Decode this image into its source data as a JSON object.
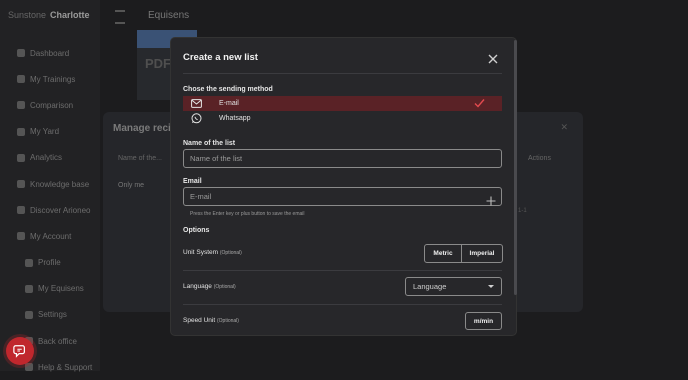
{
  "app": {
    "brand_prefix": "Sunstone",
    "brand_name": "Charlotte",
    "page_title": "Equisens",
    "card_title": "PDF"
  },
  "sidebar": {
    "items": [
      {
        "label": "Dashboard",
        "icon": "dashboard-icon"
      },
      {
        "label": "My Trainings",
        "icon": "horse-icon"
      },
      {
        "label": "Comparison",
        "icon": "compare-icon"
      },
      {
        "label": "My Yard",
        "icon": "yard-icon"
      },
      {
        "label": "Analytics",
        "icon": "analytics-icon"
      },
      {
        "label": "Knowledge base",
        "icon": "bulb-icon"
      },
      {
        "label": "Discover Arioneo",
        "icon": "globe-icon"
      },
      {
        "label": "My Account",
        "icon": "account-icon"
      },
      {
        "label": "Profile",
        "icon": "user-icon"
      },
      {
        "label": "My Equisens",
        "icon": "device-icon"
      },
      {
        "label": "Settings",
        "icon": "gear-icon"
      },
      {
        "label": "Back office",
        "icon": "shield-icon"
      },
      {
        "label": "Help & Support",
        "icon": "help-icon"
      }
    ]
  },
  "background_panel": {
    "title": "Manage recip",
    "col_name": "Name of the...",
    "col_actions": "Actions",
    "row_1": "Only me",
    "pagination": "1-1"
  },
  "modal": {
    "title": "Create a new list",
    "method_label": "Chose the sending method",
    "methods": [
      {
        "label": "E-mail",
        "icon": "mail-icon",
        "selected": true
      },
      {
        "label": "Whatsapp",
        "icon": "whatsapp-icon",
        "selected": false
      }
    ],
    "name_label": "Name of the list",
    "name_placeholder": "Name of the list",
    "email_label": "Email",
    "email_placeholder": "E-mail",
    "email_hint": "Press the Enter key or plus button to save the email",
    "options_label": "Options",
    "unit_system_label": "Unit System",
    "unit_system_optional": "(Optional)",
    "unit_metric": "Metric",
    "unit_imperial": "Imperial",
    "language_label": "Language",
    "language_optional": "(Optional)",
    "language_placeholder": "Language",
    "speed_label": "Speed Unit",
    "speed_optional": "(Optional)",
    "speed_value": "m/min"
  },
  "colors": {
    "accent_red": "#c0272d",
    "selected_row": "#5a2226"
  }
}
